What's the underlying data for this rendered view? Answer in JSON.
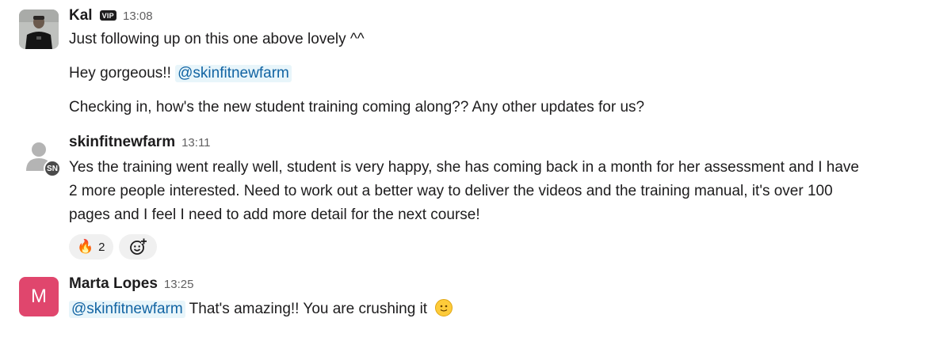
{
  "messages": [
    {
      "author": "Kal",
      "badge": "VIP",
      "time": "13:08",
      "lines": [
        "Just following up on this one above lovely ^^",
        "Hey gorgeous!!",
        "Checking in, how's the new student training coming along?? Any other updates for us?"
      ],
      "mention": "@skinfitnewfarm"
    },
    {
      "author": "skinfitnewfarm",
      "avatar_badge": "SN",
      "time": "13:11",
      "lines": [
        "Yes the training went really well,  student is very happy,  she has coming back in a month for her assessment and I have",
        "2 more people interested.  Need to work out a better way to deliver the videos and the training manual, it's over 100",
        "pages and I feel I need to add more detail for the next course!"
      ],
      "reactions": [
        {
          "emoji": "🔥",
          "count": "2"
        }
      ],
      "add_reaction_icon": "add-reaction-icon"
    },
    {
      "author": "Marta Lopes",
      "avatar_letter": "M",
      "time": "13:25",
      "mention": "@skinfitnewfarm",
      "text": "That's amazing!! You are crushing it",
      "emoji": "slightly-smiling-face"
    }
  ],
  "colors": {
    "mention_bg": "#e8f5fa",
    "mention_text": "#1264a3",
    "marta_avatar": "#e0466d",
    "reaction_bg": "#f0f0f0"
  }
}
